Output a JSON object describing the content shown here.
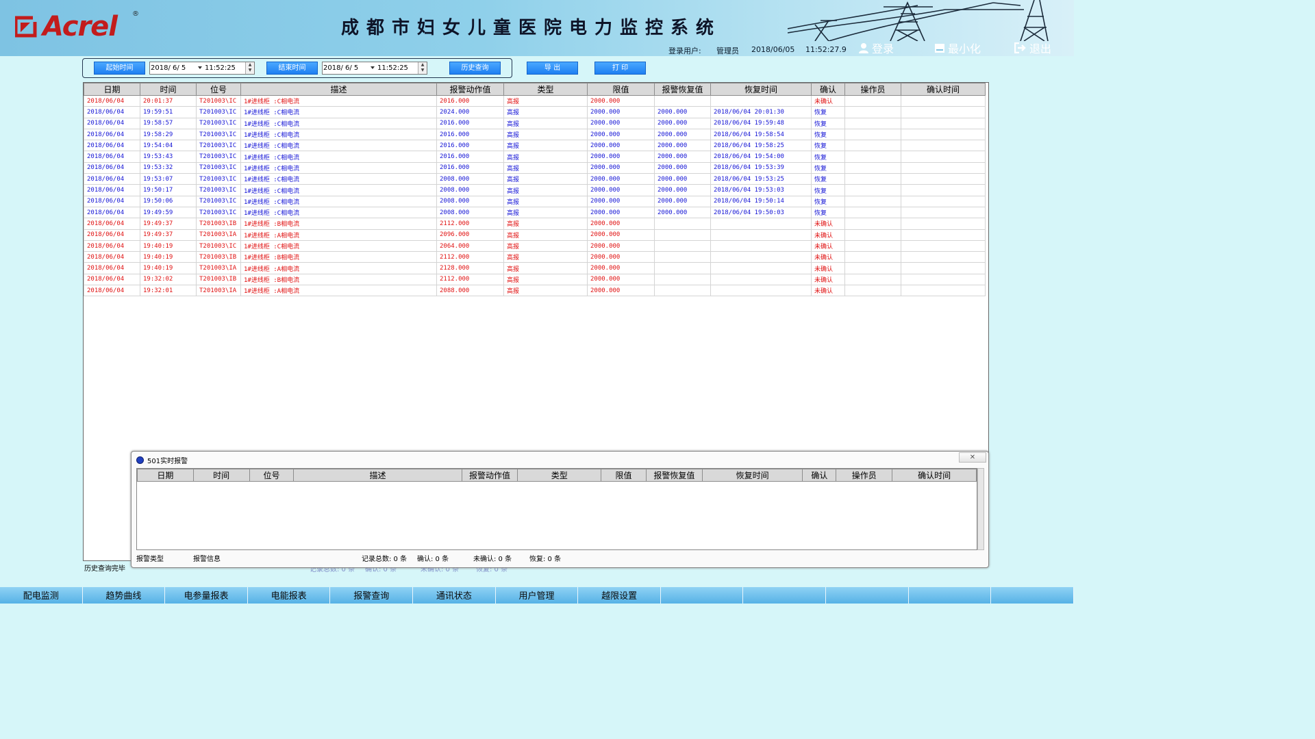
{
  "header": {
    "logo_text": "Acrel",
    "logo_reg": "®",
    "title": "成都市妇女儿童医院电力监控系统",
    "user_label": "登录用户:",
    "user_name": "管理员",
    "date": "2018/06/05",
    "time": "11:52:27.9",
    "login_label": "登录",
    "minimize_label": "最小化",
    "exit_label": "退出"
  },
  "query": {
    "start_label": "起始时间",
    "start_date": "2018/ 6/ 5",
    "start_time": "11:52:25",
    "end_label": "结束时间",
    "end_date": "2018/ 6/ 5",
    "end_time": "11:52:25",
    "history_label": "历史查询",
    "export_label": "导  出",
    "print_label": "打  印"
  },
  "columns": [
    "日期",
    "时间",
    "位号",
    "描述",
    "报警动作值",
    "类型",
    "限值",
    "报警恢复值",
    "恢复时间",
    "确认",
    "操作员",
    "确认时间"
  ],
  "rows": [
    {
      "state": "unconf",
      "cells": [
        "2018/06/04",
        "20:01:37",
        "T201003\\IC",
        "1#进线柜 :C相电流",
        "2016.000",
        "高报",
        "2000.000",
        "",
        "",
        "未确认",
        "",
        ""
      ]
    },
    {
      "state": "restored",
      "cells": [
        "2018/06/04",
        "19:59:51",
        "T201003\\IC",
        "1#进线柜 :C相电流",
        "2024.000",
        "高报",
        "2000.000",
        "2000.000",
        "2018/06/04 20:01:30",
        "恢复",
        "",
        ""
      ]
    },
    {
      "state": "restored",
      "cells": [
        "2018/06/04",
        "19:58:57",
        "T201003\\IC",
        "1#进线柜 :C相电流",
        "2016.000",
        "高报",
        "2000.000",
        "2000.000",
        "2018/06/04 19:59:48",
        "恢复",
        "",
        ""
      ]
    },
    {
      "state": "restored",
      "cells": [
        "2018/06/04",
        "19:58:29",
        "T201003\\IC",
        "1#进线柜 :C相电流",
        "2016.000",
        "高报",
        "2000.000",
        "2000.000",
        "2018/06/04 19:58:54",
        "恢复",
        "",
        ""
      ]
    },
    {
      "state": "restored",
      "cells": [
        "2018/06/04",
        "19:54:04",
        "T201003\\IC",
        "1#进线柜 :C相电流",
        "2016.000",
        "高报",
        "2000.000",
        "2000.000",
        "2018/06/04 19:58:25",
        "恢复",
        "",
        ""
      ]
    },
    {
      "state": "restored",
      "cells": [
        "2018/06/04",
        "19:53:43",
        "T201003\\IC",
        "1#进线柜 :C相电流",
        "2016.000",
        "高报",
        "2000.000",
        "2000.000",
        "2018/06/04 19:54:00",
        "恢复",
        "",
        ""
      ]
    },
    {
      "state": "restored",
      "cells": [
        "2018/06/04",
        "19:53:32",
        "T201003\\IC",
        "1#进线柜 :C相电流",
        "2016.000",
        "高报",
        "2000.000",
        "2000.000",
        "2018/06/04 19:53:39",
        "恢复",
        "",
        ""
      ]
    },
    {
      "state": "restored",
      "cells": [
        "2018/06/04",
        "19:53:07",
        "T201003\\IC",
        "1#进线柜 :C相电流",
        "2008.000",
        "高报",
        "2000.000",
        "2000.000",
        "2018/06/04 19:53:25",
        "恢复",
        "",
        ""
      ]
    },
    {
      "state": "restored",
      "cells": [
        "2018/06/04",
        "19:50:17",
        "T201003\\IC",
        "1#进线柜 :C相电流",
        "2008.000",
        "高报",
        "2000.000",
        "2000.000",
        "2018/06/04 19:53:03",
        "恢复",
        "",
        ""
      ]
    },
    {
      "state": "restored",
      "cells": [
        "2018/06/04",
        "19:50:06",
        "T201003\\IC",
        "1#进线柜 :C相电流",
        "2008.000",
        "高报",
        "2000.000",
        "2000.000",
        "2018/06/04 19:50:14",
        "恢复",
        "",
        ""
      ]
    },
    {
      "state": "restored",
      "cells": [
        "2018/06/04",
        "19:49:59",
        "T201003\\IC",
        "1#进线柜 :C相电流",
        "2008.000",
        "高报",
        "2000.000",
        "2000.000",
        "2018/06/04 19:50:03",
        "恢复",
        "",
        ""
      ]
    },
    {
      "state": "unconf",
      "cells": [
        "2018/06/04",
        "19:49:37",
        "T201003\\IB",
        "1#进线柜 :B相电流",
        "2112.000",
        "高报",
        "2000.000",
        "",
        "",
        "未确认",
        "",
        ""
      ]
    },
    {
      "state": "unconf",
      "cells": [
        "2018/06/04",
        "19:49:37",
        "T201003\\IA",
        "1#进线柜 :A相电流",
        "2096.000",
        "高报",
        "2000.000",
        "",
        "",
        "未确认",
        "",
        ""
      ]
    },
    {
      "state": "unconf",
      "cells": [
        "2018/06/04",
        "19:40:19",
        "T201003\\IC",
        "1#进线柜 :C相电流",
        "2064.000",
        "高报",
        "2000.000",
        "",
        "",
        "未确认",
        "",
        ""
      ]
    },
    {
      "state": "unconf",
      "cells": [
        "2018/06/04",
        "19:40:19",
        "T201003\\IB",
        "1#进线柜 :B相电流",
        "2112.000",
        "高报",
        "2000.000",
        "",
        "",
        "未确认",
        "",
        ""
      ]
    },
    {
      "state": "unconf",
      "cells": [
        "2018/06/04",
        "19:40:19",
        "T201003\\IA",
        "1#进线柜 :A相电流",
        "2128.000",
        "高报",
        "2000.000",
        "",
        "",
        "未确认",
        "",
        ""
      ]
    },
    {
      "state": "unconf",
      "cells": [
        "2018/06/04",
        "19:32:02",
        "T201003\\IB",
        "1#进线柜 :B相电流",
        "2112.000",
        "高报",
        "2000.000",
        "",
        "",
        "未确认",
        "",
        ""
      ]
    },
    {
      "state": "unconf",
      "cells": [
        "2018/06/04",
        "19:32:01",
        "T201003\\IA",
        "1#进线柜 :A相电流",
        "2088.000",
        "高报",
        "2000.000",
        "",
        "",
        "未确认",
        "",
        ""
      ]
    }
  ],
  "status_left": "历史查询完毕",
  "realtime": {
    "title": "501实时报警",
    "close_icon": "close-icon",
    "columns": [
      "日期",
      "时间",
      "位号",
      "描述",
      "报警动作值",
      "类型",
      "限值",
      "报警恢复值",
      "恢复时间",
      "确认",
      "操作员",
      "确认时间"
    ],
    "status": {
      "type_label": "报警类型",
      "info_label": "报警信息",
      "total": "记录总数: 0 条",
      "confirmed": "确认: 0 条",
      "unconfirmed": "未确认: 0 条",
      "restored": "恢复: 0 条"
    }
  },
  "nav_tabs": [
    "配电监测",
    "趋势曲线",
    "电参量报表",
    "电能报表",
    "报警查询",
    "通讯状态",
    "用户管理",
    "越限设置",
    "",
    "",
    "",
    "",
    ""
  ],
  "colors": {
    "unconfirmed": "#e01010",
    "restored": "#1414d6",
    "brand_red": "#c21c1c",
    "button_blue": "#1e7ff2"
  }
}
